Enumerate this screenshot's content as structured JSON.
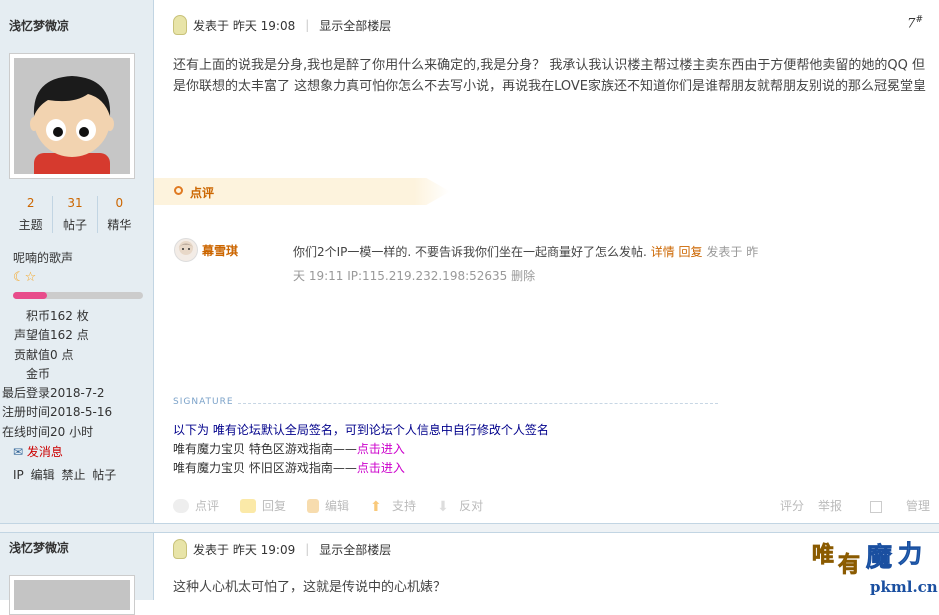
{
  "post1": {
    "author": "浅忆梦微凉",
    "stats": [
      {
        "num": "2",
        "label": "主题"
      },
      {
        "num": "31",
        "label": "帖子"
      },
      {
        "num": "0",
        "label": "精华"
      }
    ],
    "user_title": "呢喃的歌声",
    "level_progress": 0.26,
    "info": [
      {
        "key": "积分",
        "shown_key": "积币",
        "value": "162 枚"
      },
      {
        "key": "声望值",
        "shown_key": "声望值",
        "value": "162 点"
      },
      {
        "key": "贡献值",
        "shown_key": "贡献值",
        "value": "0 点"
      },
      {
        "key": "金币",
        "shown_key": "金币",
        "value": ""
      },
      {
        "key": "最后登录",
        "shown_key": "最后登录",
        "value": "2018-7-2"
      },
      {
        "key": "注册时间",
        "shown_key": "注册时间",
        "value": "2018-5-16"
      },
      {
        "key": "在线时间",
        "shown_key": "在线时间",
        "value": "20 小时"
      }
    ],
    "send_message": "发消息",
    "admin": [
      "IP",
      "编辑",
      "禁止",
      "帖子"
    ],
    "posted_at": "发表于 昨天 19:08",
    "show_all": "显示全部楼层",
    "floor": "7",
    "floor_sup": "#",
    "body": "还有上面的说我是分身,我也是醉了你用什么来确定的,我是分身？ 我承认我认识楼主帮过楼主卖东西由于方便帮他卖留的她的QQ  但是你联想的太丰富了 这想象力真可怕你怎么不去写小说，再说我在LOVE家族还不知道你们是谁帮朋友就帮朋友别说的那么冠冕堂皇",
    "dianping_label": "点评",
    "comment": {
      "user": "幕雪琪",
      "text": "你们2个IP一模一样的. 不要告诉我你们坐在一起商量好了怎么发帖.",
      "detail": "详情",
      "reply": "回复",
      "time_prefix": "发表于 昨",
      "time_line2": "天 19:11 IP:115.219.232.198:52635 删除"
    },
    "signature_label": "SIGNATURE",
    "sig1": "以下为 唯有论坛默认全局签名，可到论坛个人信息中自行修改个人签名",
    "sig2_prefix": "唯有魔力宝贝 特色区游戏指南——",
    "sig3_prefix": "唯有魔力宝贝 怀旧区游戏指南——",
    "sig_link": "点击进入",
    "actions": [
      "点评",
      "回复",
      "编辑",
      "支持",
      "反对"
    ],
    "right_actions": [
      "评分",
      "举报",
      "管理"
    ]
  },
  "post2": {
    "author": "浅忆梦微凉",
    "posted_at": "发表于 昨天 19:09",
    "show_all": "显示全部楼层",
    "body": "这种人心机太可怕了，这就是传说中的心机婊？"
  },
  "logo": {
    "text": "唯有魔力",
    "domain": "pkml.cn"
  },
  "colors": {
    "accent": "#cc6600",
    "sidebar_bg": "#e5edf2",
    "dianping_bg": "#fdf3dd"
  }
}
